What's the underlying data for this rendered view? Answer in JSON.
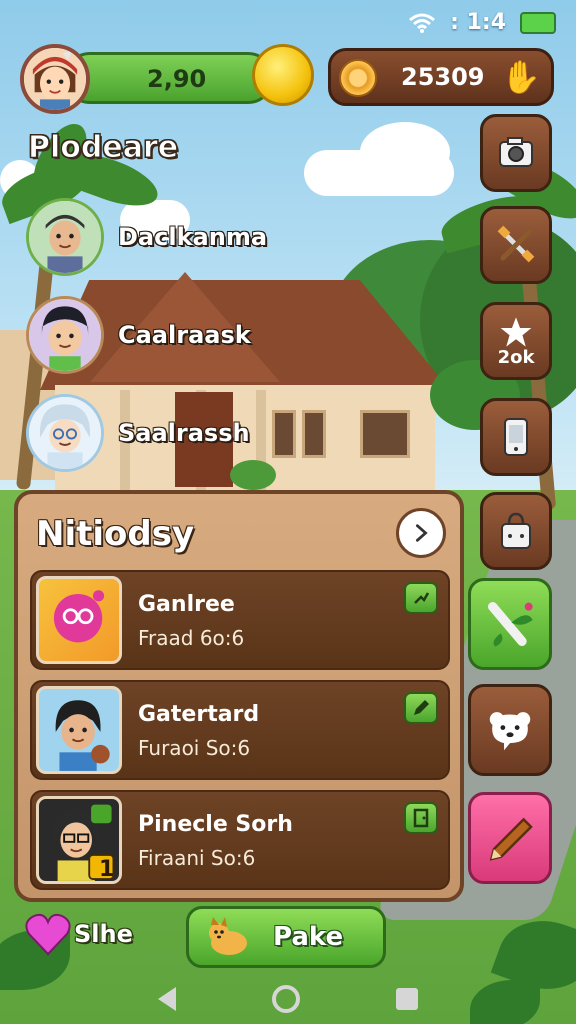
{
  "status_bar": {
    "time": ": 1:4",
    "wifi_icon": "wifi-icon",
    "battery_icon": "battery-icon"
  },
  "top_bar": {
    "coins": "2,90",
    "gold": "25309",
    "coin_icon": "coin-icon",
    "gold_icon": "gold-coin-icon",
    "hand_icon": "hand-icon"
  },
  "people": {
    "title": "Plodeare",
    "items": [
      {
        "name": "Daclkanma"
      },
      {
        "name": "Caalraask"
      },
      {
        "name": "Saalrassh"
      }
    ]
  },
  "side_buttons": [
    {
      "icon": "camera-icon"
    },
    {
      "icon": "tools-icon"
    },
    {
      "icon": "star-icon",
      "label": "2ok"
    },
    {
      "icon": "phone-icon"
    },
    {
      "icon": "bag-icon"
    },
    {
      "icon": "plant-icon"
    },
    {
      "icon": "bear-icon"
    },
    {
      "icon": "pencil-icon"
    }
  ],
  "panel": {
    "title": "Nitiodsy",
    "rows": [
      {
        "title": "Ganlree",
        "subtitle": "Fraad 6o:6"
      },
      {
        "title": "Gatertard",
        "subtitle": "Furaoi So:6"
      },
      {
        "title": "Pinecle Sorh",
        "subtitle": "Firaani So:6",
        "thumb_badge": "1"
      }
    ]
  },
  "bottom": {
    "heart_label": "Slhe",
    "play_label": "Pake"
  },
  "colors": {
    "green": "#4aa62b",
    "brown": "#6a3a22",
    "pink": "#d93a7a",
    "gold": "#f4c20d"
  }
}
